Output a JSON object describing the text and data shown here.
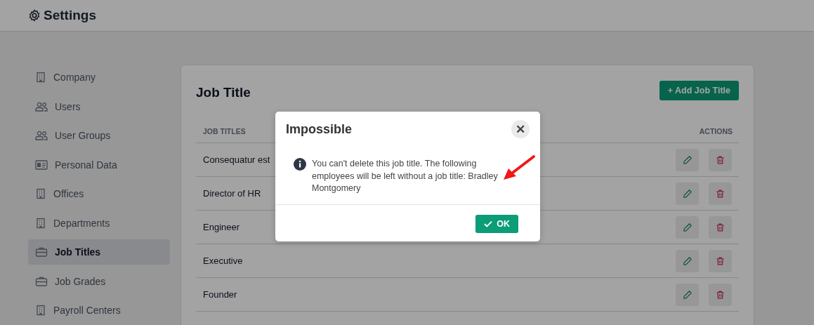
{
  "header": {
    "title": "Settings"
  },
  "sidebar": {
    "items": [
      {
        "label": "Company",
        "kind": "building",
        "selected": false
      },
      {
        "label": "Users",
        "kind": "users",
        "selected": false
      },
      {
        "label": "User Groups",
        "kind": "users",
        "selected": false
      },
      {
        "label": "Personal Data",
        "kind": "idcard",
        "selected": false
      },
      {
        "label": "Offices",
        "kind": "building",
        "selected": false
      },
      {
        "label": "Departments",
        "kind": "building",
        "selected": false
      },
      {
        "label": "Job Titles",
        "kind": "briefcase",
        "selected": true
      },
      {
        "label": "Job Grades",
        "kind": "briefcase",
        "selected": false
      },
      {
        "label": "Payroll Centers",
        "kind": "building",
        "selected": false
      }
    ]
  },
  "card": {
    "title": "Job Title",
    "add_button": "+ Add Job Title",
    "table": {
      "columns": [
        "JOB TITLES",
        "ACTIONS"
      ],
      "rows": [
        {
          "title": "Consequatur est"
        },
        {
          "title": "Director of HR"
        },
        {
          "title": "Engineer"
        },
        {
          "title": "Executive"
        },
        {
          "title": "Founder"
        }
      ]
    }
  },
  "dialog": {
    "title": "Impossible",
    "close": "✕",
    "message": "You can't delete this job title. The following employees will be left without a job title: Bradley Montgomery",
    "ok_button": "OK"
  }
}
